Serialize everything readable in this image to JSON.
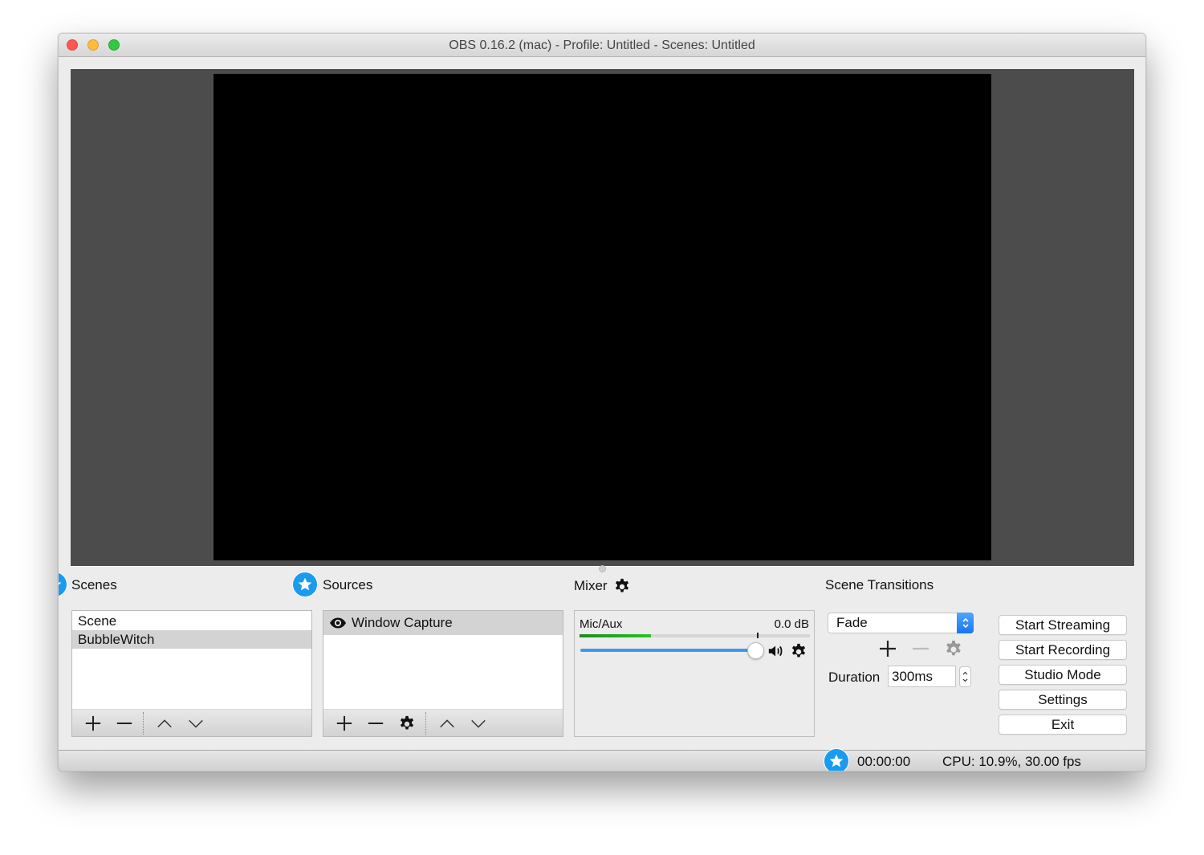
{
  "window": {
    "title": "OBS 0.16.2 (mac) - Profile: Untitled - Scenes: Untitled",
    "controls": [
      "close",
      "minimize",
      "maximize"
    ]
  },
  "preview": {
    "background_color": "#4c4c4c",
    "canvas_color": "#000000"
  },
  "scenes": {
    "title": "Scenes",
    "items": [
      {
        "label": "Scene",
        "selected": false
      },
      {
        "label": "BubbleWitch",
        "selected": true
      }
    ],
    "toolbar": [
      "add-icon",
      "remove-icon",
      "move-up-icon",
      "move-down-icon"
    ]
  },
  "sources": {
    "title": "Sources",
    "items": [
      {
        "label": "Window Capture",
        "visible": true,
        "selected": true
      }
    ],
    "toolbar": [
      "add-icon",
      "remove-icon",
      "gear-icon",
      "move-up-icon",
      "move-down-icon"
    ]
  },
  "mixer": {
    "title": "Mixer",
    "channels": [
      {
        "name": "Mic/Aux",
        "db_label": "0.0 dB",
        "meter_level_fraction": 0.31,
        "peak_fraction": 0.77,
        "volume_fraction": 1.0
      }
    ]
  },
  "transitions": {
    "title": "Scene Transitions",
    "selected": "Fade",
    "duration_label": "Duration",
    "duration_value": "300ms"
  },
  "controls": {
    "buttons": [
      "Start Streaming",
      "Start Recording",
      "Studio Mode",
      "Settings",
      "Exit"
    ]
  },
  "status": {
    "time": "00:00:00",
    "cpu_fps": "CPU: 10.9%, 30.00 fps"
  },
  "colors": {
    "accent": "#1a9bf0",
    "volume_fill": "#3c98f2",
    "meter_green": "#2cc12c"
  }
}
